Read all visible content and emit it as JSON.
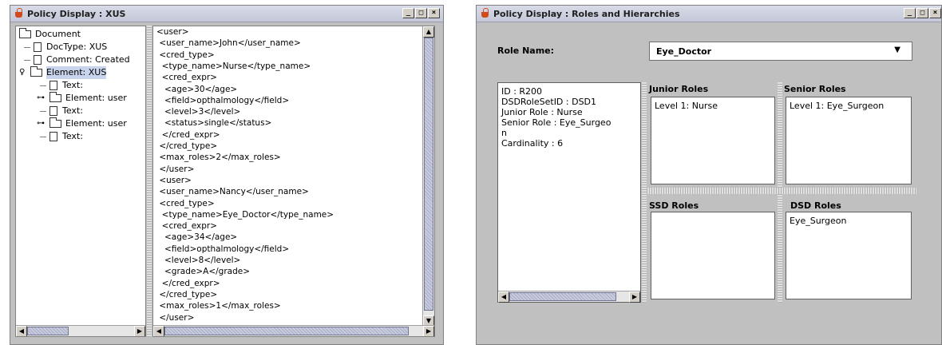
{
  "left_window": {
    "title": "Policy Display : XUS",
    "controls": [
      "_",
      "□",
      "×"
    ],
    "tree": [
      {
        "label": "Document",
        "icon": "folder-icon"
      },
      {
        "label": "DocType: XUS",
        "icon": "document-icon"
      },
      {
        "label": "Comment: Created",
        "icon": "document-icon"
      },
      {
        "label": "Element: XUS",
        "icon": "folder-icon",
        "selected": true
      },
      {
        "label": "Text:",
        "icon": "document-icon"
      },
      {
        "label": "Element: user",
        "icon": "folder-icon"
      },
      {
        "label": "Text:",
        "icon": "document-icon"
      },
      {
        "label": "Element: user",
        "icon": "folder-icon"
      },
      {
        "label": "Text:",
        "icon": "document-icon"
      }
    ],
    "xml_lines": [
      "<user>",
      " <user_name>John</user_name>",
      " <cred_type>",
      "  <type_name>Nurse</type_name>",
      "  <cred_expr>",
      "   <age>30</age>",
      "   <field>opthalmology</field>",
      "   <level>3</level>",
      "   <status>single</status>",
      "  </cred_expr>",
      " </cred_type>",
      " <max_roles>2</max_roles>",
      " </user>",
      " <user>",
      " <user_name>Nancy</user_name>",
      " <cred_type>",
      "  <type_name>Eye_Doctor</type_name>",
      "  <cred_expr>",
      "   <age>34</age>",
      "   <field>opthalmology</field>",
      "   <level>8</level>",
      "   <grade>A</grade>",
      "  </cred_expr>",
      " </cred_type>",
      " <max_roles>1</max_roles>",
      " </user>"
    ]
  },
  "right_window": {
    "title": "Policy Display : Roles and Hierarchies",
    "controls": [
      "_",
      "□",
      "×"
    ],
    "role_name_label": "Role Name:",
    "role_name_value": "Eye_Doctor",
    "details": [
      "ID : R200",
      "DSDRoleSetID : DSD1",
      "Junior Role : Nurse",
      "Senior Role : Eye_Surgeo",
      "n",
      "Cardinality : 6"
    ],
    "junior_roles_header": "Junior Roles",
    "senior_roles_header": "Senior Roles",
    "ssd_roles_header": "SSD Roles",
    "dsd_roles_header": "DSD Roles",
    "junior_roles": [
      "Level 1: Nurse"
    ],
    "senior_roles": [
      "Level 1: Eye_Surgeon"
    ],
    "ssd_roles": [],
    "dsd_roles": [
      "Eye_Surgeon"
    ]
  }
}
